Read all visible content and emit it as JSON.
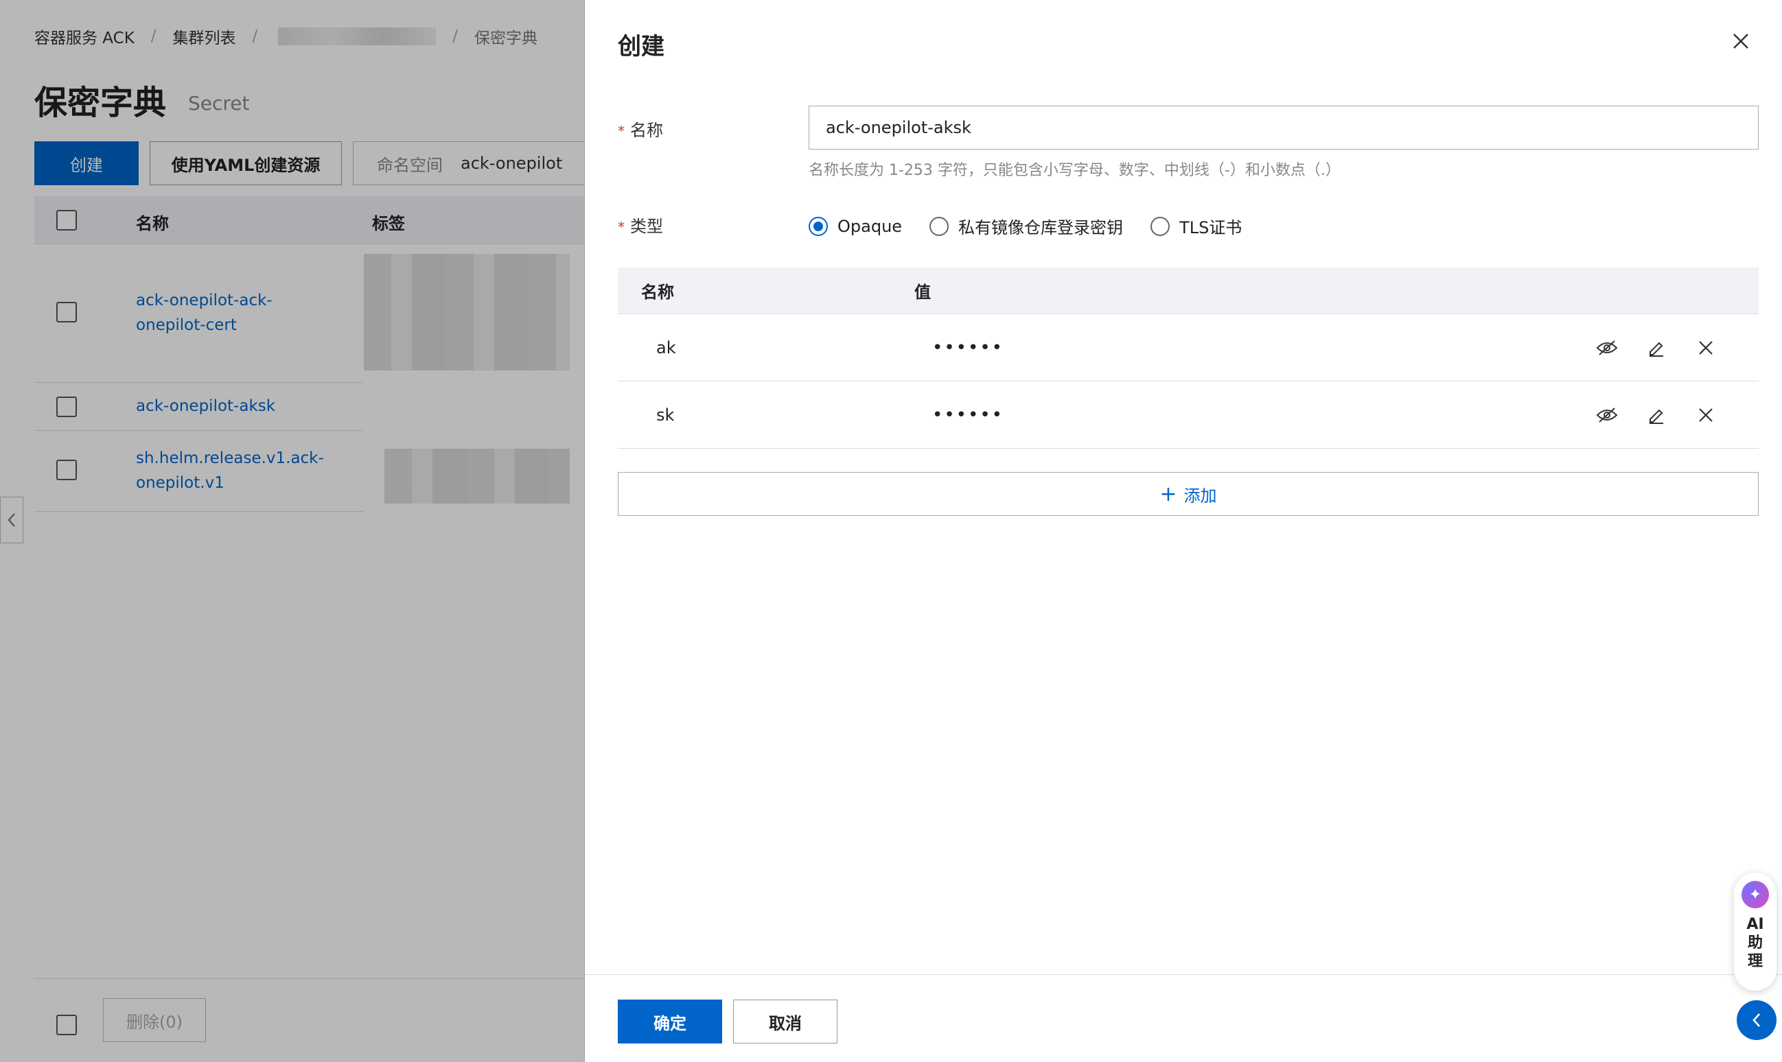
{
  "background": {
    "breadcrumb": [
      "容器服务 ACK",
      "集群列表",
      "保密字典"
    ],
    "breadcrumb_sep": "/",
    "title": "保密字典",
    "subtitle": "Secret",
    "create_label": "创建",
    "yaml_label": "使用YAML创建资源",
    "namespace_label": "命名空间",
    "namespace_value": "ack-onepilot",
    "table_headers": [
      "名称",
      "标签"
    ],
    "rows": [
      "ack-onepilot-ack-onepilot-cert",
      "ack-onepilot-aksk",
      "sh.helm.release.v1.ack-onepilot.v1"
    ],
    "delete_label": "删除(0)"
  },
  "drawer": {
    "title": "创建",
    "name_label": "名称",
    "name_value": "ack-onepilot-aksk",
    "name_hint": "名称长度为 1-253 字符，只能包含小写字母、数字、中划线（-）和小数点（.）",
    "type_label": "类型",
    "type_options": [
      "Opaque",
      "私有镜像仓库登录密钥",
      "TLS证书"
    ],
    "type_selected": "Opaque",
    "kv_headers": [
      "名称",
      "值"
    ],
    "kv_rows": [
      {
        "key": "ak",
        "value": "••••••"
      },
      {
        "key": "sk",
        "value": "••••••"
      }
    ],
    "add_label": "添加",
    "ok_label": "确定",
    "cancel_label": "取消"
  },
  "assistant": {
    "label": "AI助理"
  },
  "colors": {
    "primary": "#0064c8",
    "required": "#d93026"
  }
}
